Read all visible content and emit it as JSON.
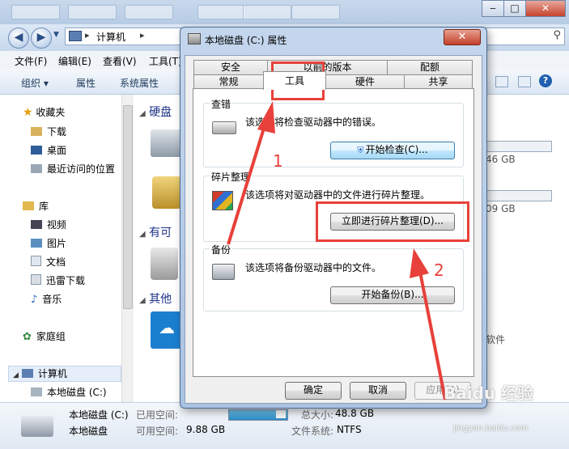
{
  "explorer": {
    "breadcrumb": "计算机",
    "menu": [
      "文件(F)",
      "编辑(E)",
      "查看(V)",
      "工具(T)"
    ],
    "toolbar": [
      "组织 ▾",
      "属性",
      "系统属性"
    ],
    "nav": {
      "favorites": "收藏夹",
      "fav_items": [
        "下载",
        "桌面",
        "最近访问的位置"
      ],
      "libraries": "库",
      "lib_items": [
        "视频",
        "图片",
        "文档",
        "迅雷下载",
        "音乐"
      ],
      "homegroup": "家庭组",
      "computer": "计算机",
      "local_disk": "本地磁盘 (C:)"
    },
    "content": {
      "group_hdd": "硬盘",
      "group_removable": "有可",
      "group_other": "其他",
      "free1": "46 GB",
      "free2": "09 GB",
      "software": "软件"
    },
    "status": {
      "name": "本地磁盘 (C:)",
      "type": "本地磁盘",
      "used_label": "已用空间:",
      "free_label": "可用空间:",
      "free_value": "9.88 GB",
      "total_label": "总大小:",
      "total_value": "48.8 GB",
      "fs_label": "文件系统:",
      "fs_value": "NTFS",
      "used_fraction": 0.8
    }
  },
  "dialog": {
    "title": "本地磁盘 (C:) 属性",
    "close": "✕",
    "tabs_row1": [
      "安全",
      "以前的版本",
      "配额"
    ],
    "tabs_row2": [
      "常规",
      "工具",
      "硬件",
      "共享"
    ],
    "active_tab": "工具",
    "check": {
      "label": "查错",
      "text": "该选项将检查驱动器中的错误。",
      "button": "开始检查(C)..."
    },
    "defrag": {
      "label": "碎片整理",
      "text": "该选项将对驱动器中的文件进行碎片整理。",
      "button": "立即进行碎片整理(D)..."
    },
    "backup": {
      "label": "备份",
      "text": "该选项将备份驱动器中的文件。",
      "button": "开始备份(B)..."
    },
    "ok": "确定",
    "cancel": "取消",
    "apply": "应用(A)"
  },
  "annotations": {
    "step1": "1",
    "step2": "2",
    "color": "#e8403a"
  },
  "watermark": {
    "brand": "Baidu 经验",
    "url": "jingyan.baidu.com"
  }
}
